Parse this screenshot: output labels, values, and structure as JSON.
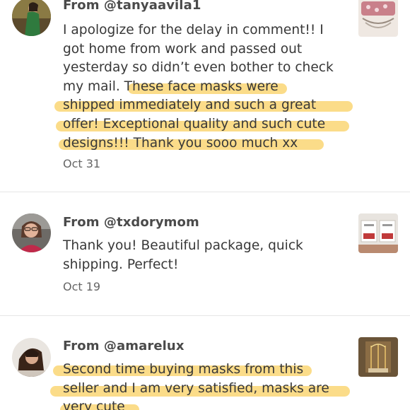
{
  "reviews": [
    {
      "from": "From @tanyaavila1",
      "lines": [
        "I apologize for the delay in comment!! I",
        "got home from work and passed out",
        "yesterday so didn’t even bother to check",
        "my mail.   These face masks were",
        "shipped immediately and such a great",
        "offer! Exceptional quality and such cute",
        "designs!!! Thank you sooo much xx"
      ],
      "date": "Oct 31"
    },
    {
      "from": "From @txdorymom",
      "lines": [
        "Thank you! Beautiful package, quick",
        "shipping. Perfect!"
      ],
      "date": "Oct 19"
    },
    {
      "from": "From @amarelux",
      "lines": [
        "Second time buying masks from this",
        "seller and I am very satisfied, masks are",
        "very cute"
      ],
      "date": ""
    }
  ],
  "colors": {
    "highlight": "#face5c",
    "text": "#383838",
    "date": "#666666",
    "divider": "#e6e6e6"
  }
}
